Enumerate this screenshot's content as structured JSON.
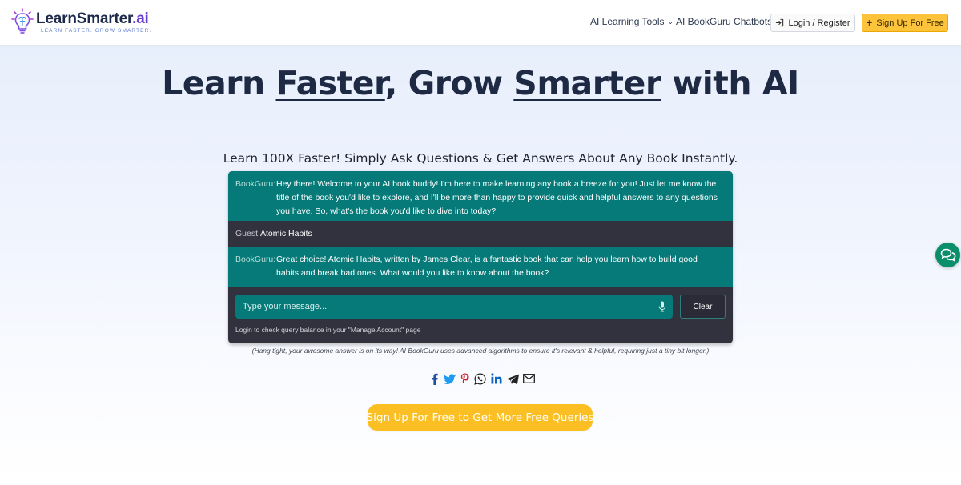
{
  "brand": {
    "name_main": "LearnSmarter",
    "name_suffix": ".ai",
    "tagline": "LEARN FASTER. GROW SMARTER."
  },
  "nav": {
    "tools_label": "AI Learning Tools",
    "chatbots_label": "AI BookGuru Chatbots",
    "login_label": "Login / Register",
    "signup_label": "Sign Up For Free"
  },
  "hero": {
    "title_part1": "Learn ",
    "title_word1": "Faster",
    "title_part2": ", Grow ",
    "title_word2": "Smarter",
    "title_part3": " with AI",
    "subtitle": "Learn 100X Faster! Simply Ask Questions & Get Answers About Any Book Instantly."
  },
  "chat": {
    "messages": [
      {
        "speaker": "BookGuru:",
        "text": "Hey there! Welcome to your AI book buddy! I'm here to make learning any book a breeze for you! Just let me know the title of the book you'd like to explore, and I'll be more than happy to provide quick and helpful answers to any questions you have. So, what's the book you'd like to dive into today?"
      },
      {
        "speaker": "Guest:",
        "text": "Atomic Habits"
      },
      {
        "speaker": "BookGuru:",
        "text": "Great choice! Atomic Habits, written by James Clear, is a fantastic book that can help you learn how to build good habits and break bad ones. What would you like to know about the book?"
      }
    ],
    "input_placeholder": "Type your message...",
    "input_value": "",
    "clear_label": "Clear",
    "balance_note": "Login to check query balance in your \"Manage Account\" page"
  },
  "hang_tight": "(Hang tight, your awesome answer is on its way! AI BookGuru uses advanced algorithms to ensure it's relevant & helpful, requiring just a tiny bit longer.)",
  "share_icons": [
    "facebook-icon",
    "twitter-icon",
    "pinterest-icon",
    "whatsapp-icon",
    "linkedin-icon",
    "telegram-icon",
    "email-icon"
  ],
  "cta_label": "Sign Up For Free to Get More Free Queries",
  "colors": {
    "teal": "#067a78",
    "dark": "#32323f",
    "amber": "#fbbf24",
    "brand_purple": "#6b3fd6",
    "float_green": "#0a8f6a"
  }
}
